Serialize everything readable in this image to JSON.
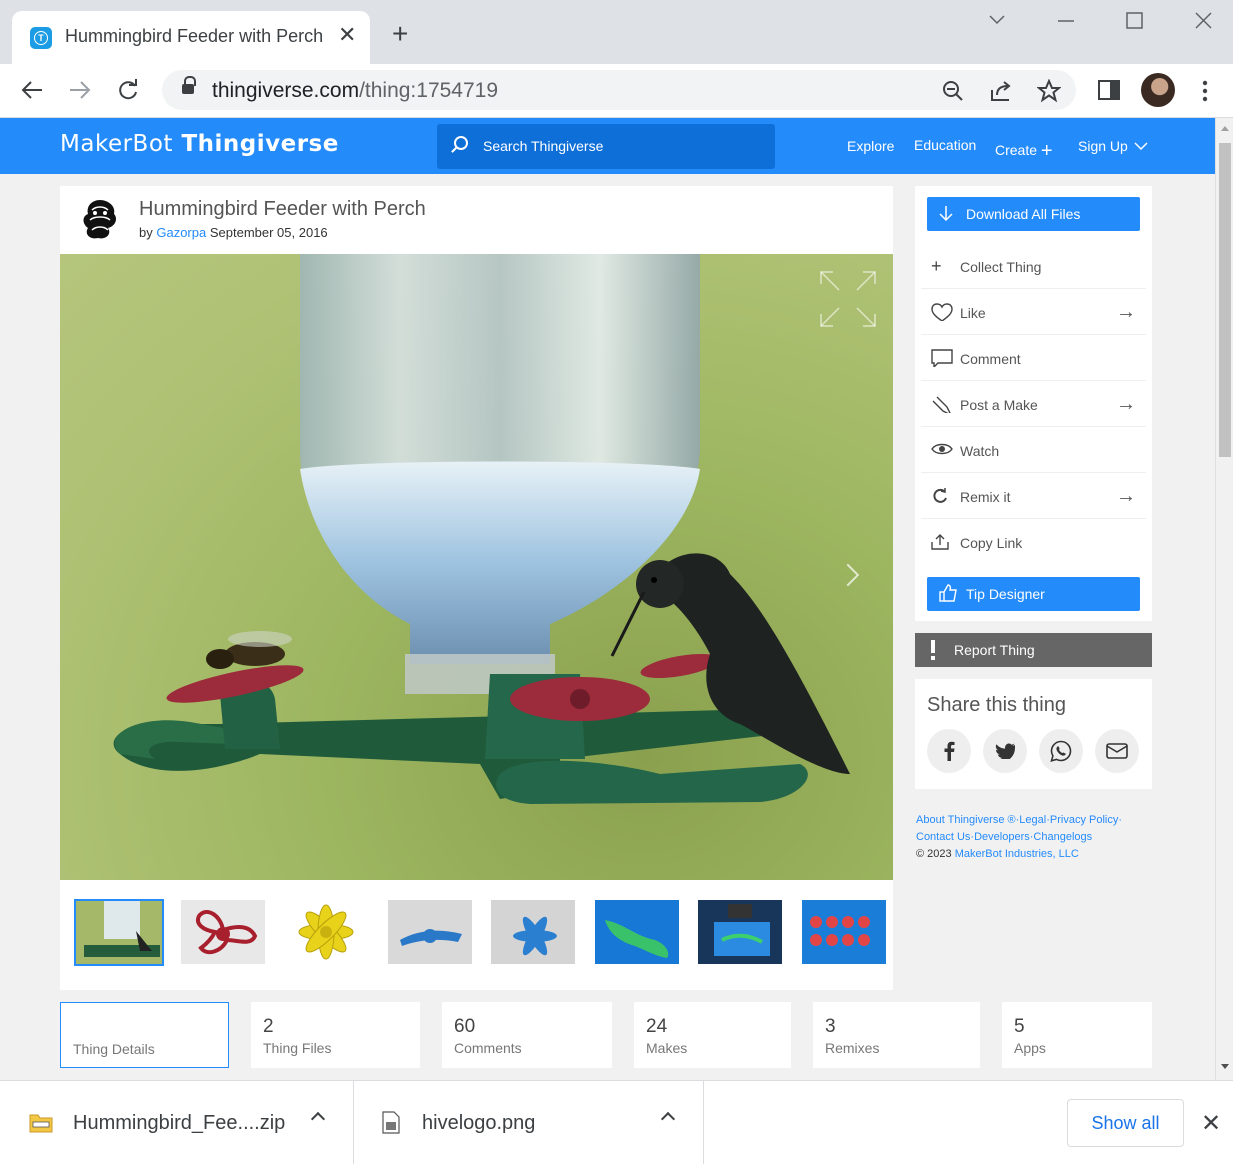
{
  "browser": {
    "tab_title": "Hummingbird Feeder with Perch",
    "url_domain": "thingiverse.com",
    "url_path": "/thing:1754719"
  },
  "site": {
    "logo_makerbot": "MakerBot",
    "logo_thingiverse": "Thingiverse",
    "search_placeholder": "Search Thingiverse",
    "nav": {
      "explore": "Explore",
      "education": "Education",
      "create": "Create",
      "signup": "Sign Up"
    },
    "brand_color": "#248bfb"
  },
  "thing": {
    "title": "Hummingbird Feeder with Perch",
    "by": "by",
    "author": "Gazorpa",
    "date": "September 05, 2016"
  },
  "actions": {
    "download": "Download All Files",
    "collect": "Collect Thing",
    "like": "Like",
    "comment": "Comment",
    "post_make": "Post a Make",
    "watch": "Watch",
    "remix": "Remix it",
    "copy_link": "Copy Link",
    "tip": "Tip Designer",
    "report": "Report Thing"
  },
  "share": {
    "title": "Share this thing"
  },
  "footer": {
    "about": "About Thingiverse ®",
    "legal": "Legal",
    "privacy": "Privacy Policy",
    "contact": "Contact Us",
    "developers": "Developers",
    "changelogs": "Changelogs",
    "copyright": "© 2023",
    "company": "MakerBot Industries, LLC"
  },
  "stats": [
    {
      "num": "",
      "label": "Thing Details"
    },
    {
      "num": "2",
      "label": "Thing Files"
    },
    {
      "num": "60",
      "label": "Comments"
    },
    {
      "num": "24",
      "label": "Makes"
    },
    {
      "num": "3",
      "label": "Remixes"
    },
    {
      "num": "5",
      "label": "Apps"
    }
  ],
  "downloads": {
    "file1": "Hummingbird_Fee....zip",
    "file2": "hivelogo.png",
    "show_all": "Show all"
  }
}
